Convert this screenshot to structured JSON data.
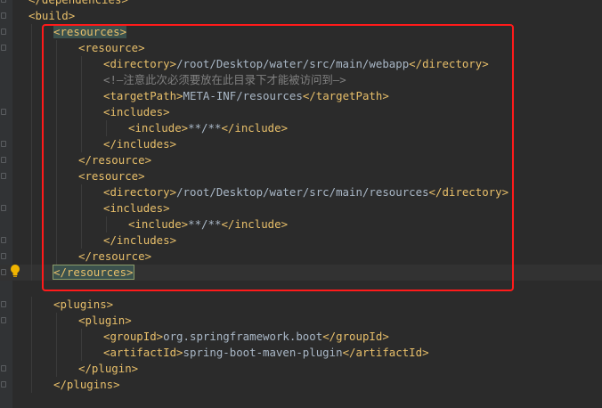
{
  "editor": {
    "lines": [
      {
        "indent": 0,
        "parts": [
          [
            "tag",
            "</dependencies>"
          ]
        ]
      },
      {
        "indent": 0,
        "parts": [
          [
            "tag",
            "<build>"
          ]
        ]
      },
      {
        "indent": 1,
        "parts": [
          [
            "tag-hl",
            "<resources>"
          ]
        ]
      },
      {
        "indent": 2,
        "parts": [
          [
            "tag",
            "<resource>"
          ]
        ]
      },
      {
        "indent": 3,
        "parts": [
          [
            "tag",
            "<directory>"
          ],
          [
            "txt",
            "/root/Desktop/water/src/main/webapp"
          ],
          [
            "tag",
            "</directory>"
          ]
        ]
      },
      {
        "indent": 3,
        "parts": [
          [
            "cmt",
            "<!—注意此次必须要放在此目录下才能被访问到—>"
          ]
        ]
      },
      {
        "indent": 3,
        "parts": [
          [
            "tag",
            "<targetPath>"
          ],
          [
            "txt",
            "META-INF/resources"
          ],
          [
            "tag",
            "</targetPath>"
          ]
        ]
      },
      {
        "indent": 3,
        "parts": [
          [
            "tag",
            "<includes>"
          ]
        ]
      },
      {
        "indent": 4,
        "parts": [
          [
            "tag",
            "<include>"
          ],
          [
            "txt",
            "**/**"
          ],
          [
            "tag",
            "</include>"
          ]
        ]
      },
      {
        "indent": 3,
        "parts": [
          [
            "tag",
            "</includes>"
          ]
        ]
      },
      {
        "indent": 2,
        "parts": [
          [
            "tag",
            "</resource>"
          ]
        ]
      },
      {
        "indent": 2,
        "parts": [
          [
            "tag",
            "<resource>"
          ]
        ]
      },
      {
        "indent": 3,
        "parts": [
          [
            "tag",
            "<directory>"
          ],
          [
            "txt",
            "/root/Desktop/water/src/main/resources"
          ],
          [
            "tag",
            "</directory>"
          ]
        ]
      },
      {
        "indent": 3,
        "parts": [
          [
            "tag",
            "<includes>"
          ]
        ]
      },
      {
        "indent": 4,
        "parts": [
          [
            "tag",
            "<include>"
          ],
          [
            "txt",
            "**/**"
          ],
          [
            "tag",
            "</include>"
          ]
        ]
      },
      {
        "indent": 3,
        "parts": [
          [
            "tag",
            "</includes>"
          ]
        ]
      },
      {
        "indent": 2,
        "parts": [
          [
            "tag",
            "</resource>"
          ]
        ]
      },
      {
        "indent": 1,
        "parts": [
          [
            "tag-hl",
            "</resources>"
          ]
        ],
        "current": true
      },
      {
        "indent": 0,
        "parts": []
      },
      {
        "indent": 1,
        "parts": [
          [
            "tag",
            "<plugins>"
          ]
        ]
      },
      {
        "indent": 2,
        "parts": [
          [
            "tag",
            "<plugin>"
          ]
        ]
      },
      {
        "indent": 3,
        "parts": [
          [
            "tag",
            "<groupId>"
          ],
          [
            "txt",
            "org.springframework.boot"
          ],
          [
            "tag",
            "</groupId>"
          ]
        ]
      },
      {
        "indent": 3,
        "parts": [
          [
            "tag",
            "<artifactId>"
          ],
          [
            "txt",
            "spring-boot-maven-plugin"
          ],
          [
            "tag",
            "</artifactId>"
          ]
        ]
      },
      {
        "indent": 2,
        "parts": [
          [
            "tag",
            "</plugin>"
          ]
        ]
      },
      {
        "indent": 1,
        "parts": [
          [
            "tag",
            "</plugins>"
          ]
        ]
      }
    ],
    "gutter_icons": {
      "intention_bulb": "lightbulb-icon"
    },
    "colors": {
      "background": "#2b2b2b",
      "tag": "#e8bf6a",
      "text": "#a9b7c6",
      "comment": "#808080",
      "annotation_box": "#ff1a1a"
    }
  }
}
